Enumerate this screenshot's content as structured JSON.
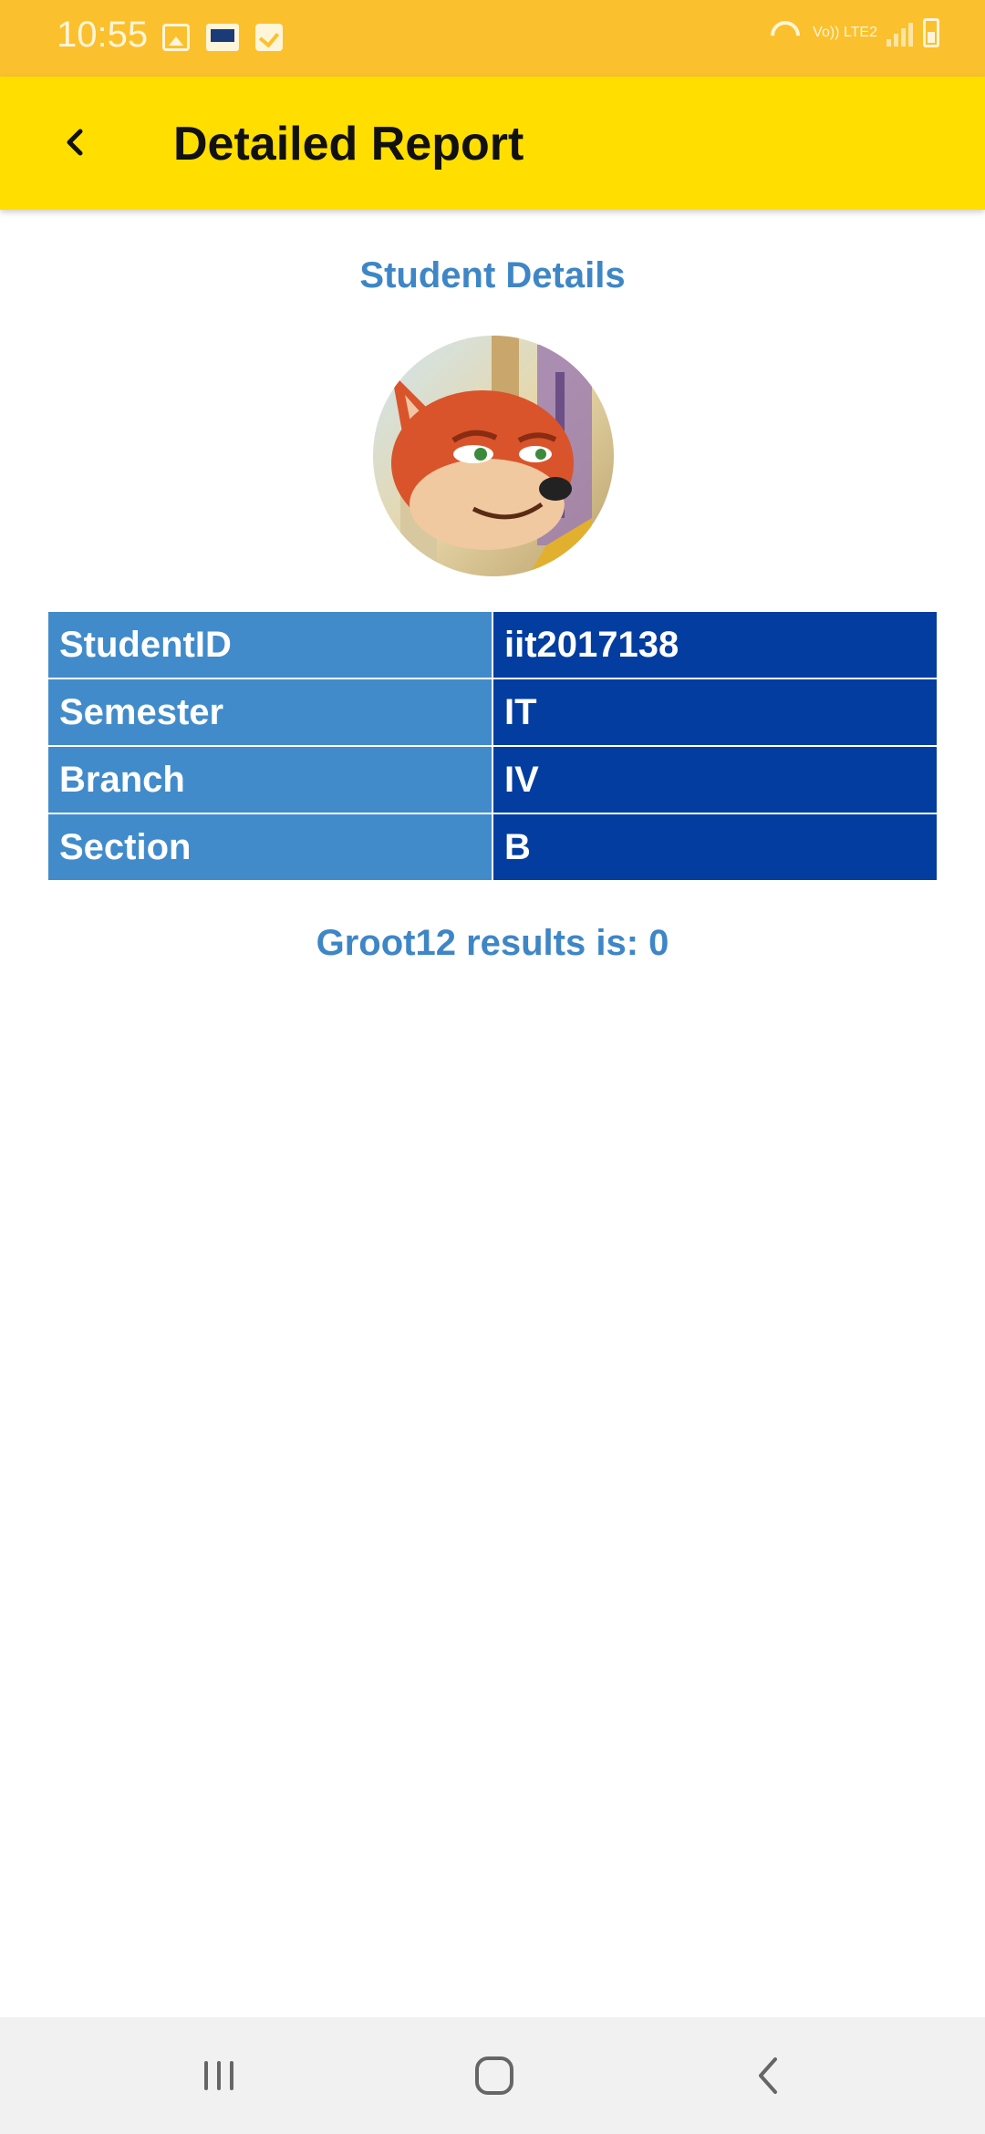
{
  "status_bar": {
    "time": "10:55",
    "network_label": "Vo)) LTE2",
    "icons": [
      "gallery-icon",
      "book-icon",
      "check-icon",
      "wifi-icon",
      "signal-icon",
      "battery-icon"
    ]
  },
  "app_bar": {
    "title": "Detailed Report",
    "back_icon": "back-arrow-icon",
    "background": "#FFDE00"
  },
  "student_details": {
    "heading": "Student Details",
    "avatar": "fox-avatar",
    "rows": [
      {
        "label": "StudentID",
        "value": "iit2017138"
      },
      {
        "label": "Semester",
        "value": "IT"
      },
      {
        "label": "Branch",
        "value": "IV"
      },
      {
        "label": "Section",
        "value": "B"
      }
    ]
  },
  "results": {
    "text": "Groot12 results is: 0"
  },
  "colors": {
    "accent_text": "#3E86C6",
    "key_cell": "#418BCA",
    "value_cell": "#033D9F",
    "status_bar": "#FBC02D"
  },
  "nav_bar": {
    "icons": [
      "recents-icon",
      "home-icon",
      "back-icon"
    ]
  }
}
